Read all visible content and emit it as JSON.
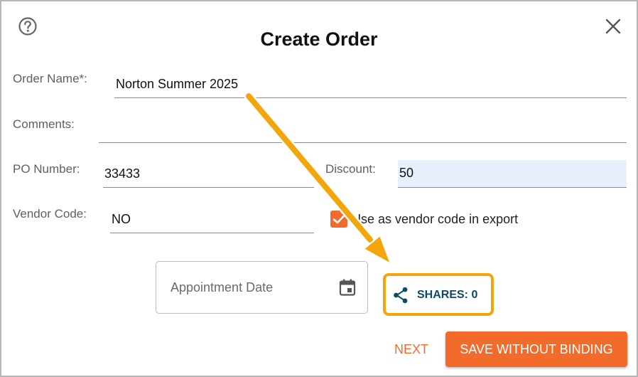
{
  "dialog": {
    "title": "Create Order",
    "accent_color": "#f26b2b",
    "highlight_color": "#f2a60c"
  },
  "fields": {
    "order_name": {
      "label": "Order Name*:",
      "value": "Norton Summer 2025"
    },
    "comments": {
      "label": "Comments:",
      "value": ""
    },
    "po_number": {
      "label": "PO Number:",
      "value": "33433"
    },
    "discount": {
      "label": "Discount:",
      "value": "50"
    },
    "vendor_code": {
      "label": "Vendor Code:",
      "value": "NO"
    },
    "use_vendor_code": {
      "label": "Use as vendor code in export",
      "checked": true
    },
    "appointment_date": {
      "placeholder": "Appointment Date"
    }
  },
  "shares": {
    "label": "SHARES: 0",
    "icon": "share-icon"
  },
  "actions": {
    "next_label": "NEXT",
    "save_label": "SAVE WITHOUT BINDING"
  }
}
